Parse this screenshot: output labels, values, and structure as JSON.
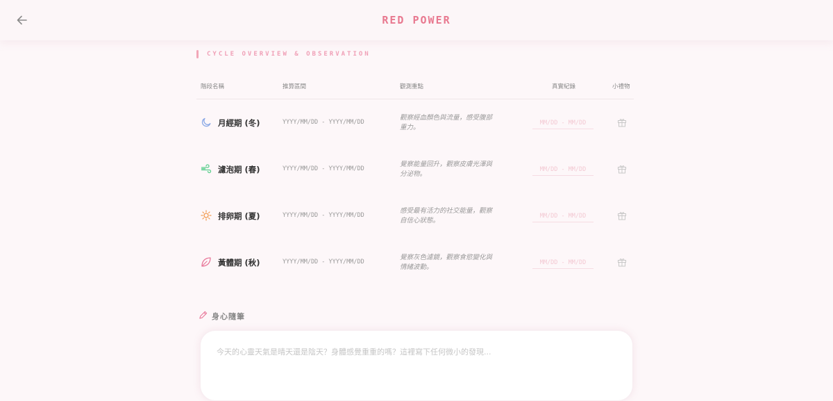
{
  "header": {
    "title": "RED POWER"
  },
  "section": {
    "title": "CYCLE OVERVIEW & OBSERVATION"
  },
  "table": {
    "columns": [
      "階段名稱",
      "推算區間",
      "觀測重點",
      "真實紀錄",
      "小禮物"
    ],
    "rows": [
      {
        "icon": "moon-icon",
        "name": "月經期 (冬)",
        "range": "YYYY/MM/DD - YYYY/MM/DD",
        "observation": "觀察經血顏色與流量，感受腹部重力。",
        "record_placeholder": "MM/DD - MM/DD"
      },
      {
        "icon": "wind-icon",
        "name": "濾泡期 (春)",
        "range": "YYYY/MM/DD - YYYY/MM/DD",
        "observation": "覺察能量回升，觀察皮膚光澤與分泌物。",
        "record_placeholder": "MM/DD - MM/DD"
      },
      {
        "icon": "sun-icon",
        "name": "排卵期 (夏)",
        "range": "YYYY/MM/DD - YYYY/MM/DD",
        "observation": "感受最有活力的社交能量，觀察自信心狀態。",
        "record_placeholder": "MM/DD - MM/DD"
      },
      {
        "icon": "leaf-icon",
        "name": "黃體期 (秋)",
        "range": "YYYY/MM/DD - YYYY/MM/DD",
        "observation": "覺察灰色濾鏡，觀察食慾變化與情緒波動。",
        "record_placeholder": "MM/DD - MM/DD"
      }
    ]
  },
  "journal": {
    "title": "身心隨筆",
    "placeholder": "今天的心靈天氣是晴天還是陰天？身體感覺重重的嗎？這裡寫下任何微小的發現..."
  },
  "colors": {
    "accent": "#e8788f",
    "moon": "#8aa8e6",
    "wind": "#5ccf8f",
    "sun": "#f29a4e",
    "leaf": "#e8789a"
  }
}
